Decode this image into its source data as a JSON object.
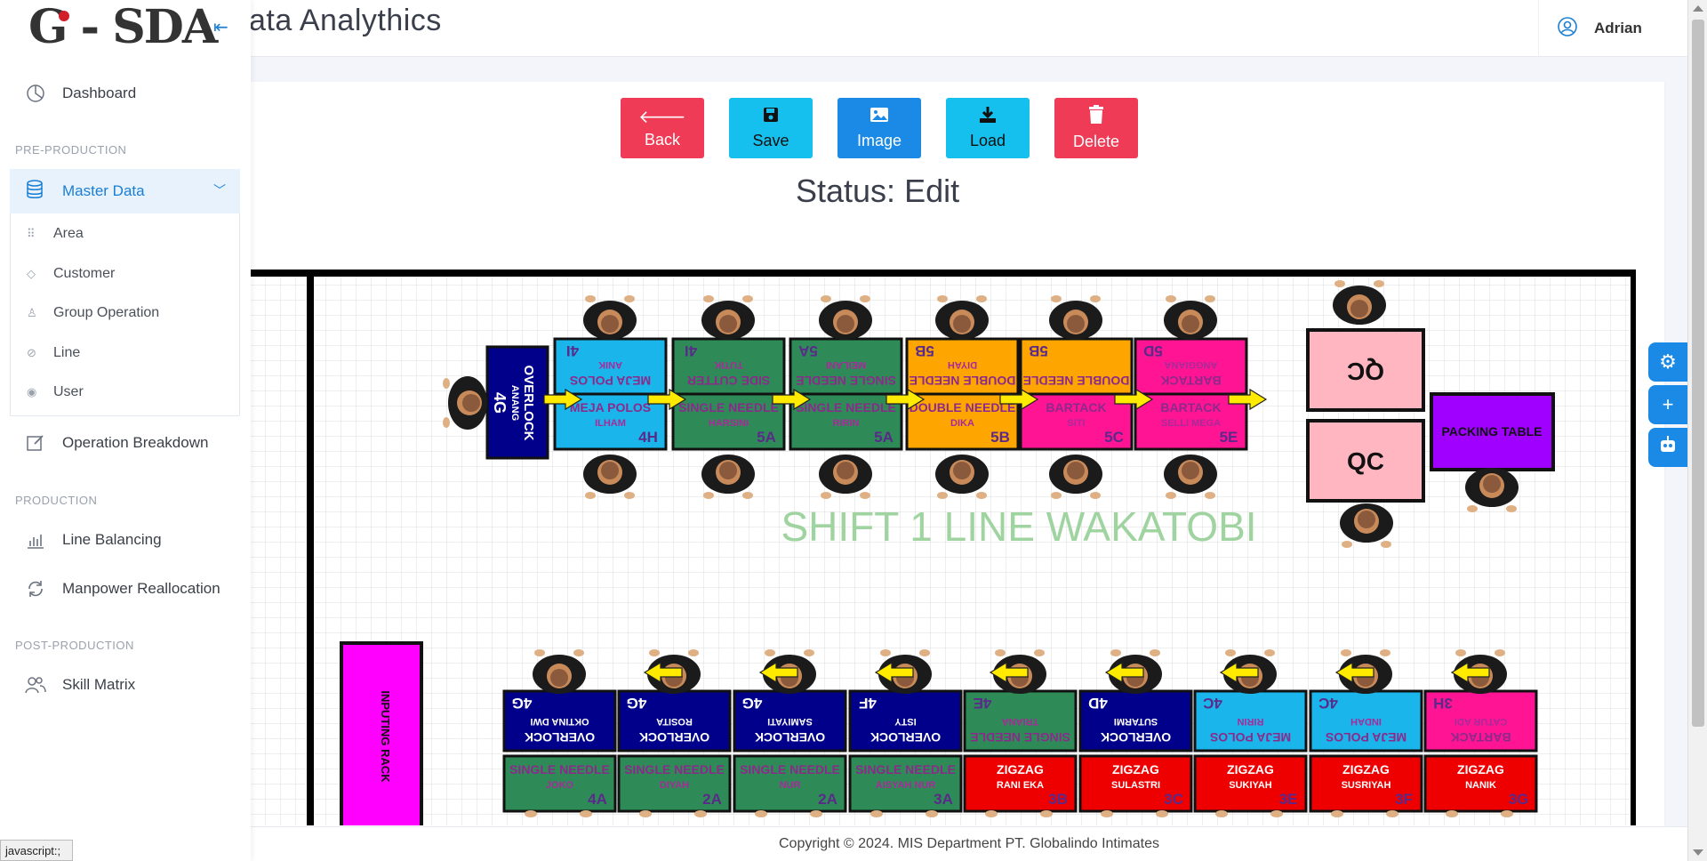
{
  "app": {
    "logo_text": "G - SDA",
    "page_title": "ata Analythics",
    "user_name": "Adrian"
  },
  "sidebar": {
    "dashboard": "Dashboard",
    "pre_production": "PRE-PRODUCTION",
    "master_data": "Master Data",
    "master_items": [
      "Area",
      "Customer",
      "Group Operation",
      "Line",
      "User"
    ],
    "operation_breakdown": "Operation Breakdown",
    "production": "PRODUCTION",
    "line_balancing": "Line Balancing",
    "manpower_reallocation": "Manpower Reallocation",
    "post_production": "POST-PRODUCTION",
    "skill_matrix": "Skill Matrix"
  },
  "toolbar": {
    "back": "Back",
    "save": "Save",
    "image": "Image",
    "load": "Load",
    "delete": "Delete"
  },
  "status_text": "Status: Edit",
  "floor": {
    "line_label": "SHIFT 1 LINE WAKATOBI",
    "packing_table": "PACKING TABLE",
    "qc1": "QC",
    "qc2": "QC",
    "inputing_rack": "INPUTING RACK",
    "overlock_vertical": {
      "machine": "OVERLOCK",
      "operator": "ANANG",
      "code": "4G"
    },
    "top_row_upper": [
      {
        "machine": "MEJA POLOS",
        "operator": "ANIK",
        "code": "4I",
        "color": "#1ab5ea"
      },
      {
        "machine": "SIDE CUTTER",
        "operator": "TUTIK",
        "code": "4I",
        "color": "#2e8b57"
      },
      {
        "machine": "SINGLE NEEDLE",
        "operator": "MEILANI",
        "code": "5A",
        "color": "#2e8b57"
      },
      {
        "machine": "DOUBLE NEEDLE",
        "operator": "DIYAH",
        "code": "5B",
        "color": "#ffa500"
      },
      {
        "machine": "DOUBLE NEEDLE",
        "operator": "",
        "code": "5B",
        "color": "#ffa500"
      },
      {
        "machine": "BARTACK",
        "operator": "ANGGIANA",
        "code": "5D",
        "color": "#ff1493"
      }
    ],
    "top_row_lower": [
      {
        "machine": "MEJA POLOS",
        "operator": "ILHAM",
        "code": "4H",
        "color": "#1ab5ea"
      },
      {
        "machine": "SINGLE NEEDLE",
        "operator": "HARSINI",
        "code": "5A",
        "color": "#2e8b57"
      },
      {
        "machine": "SINGLE NEEDLE",
        "operator": "RIRIN",
        "code": "5A",
        "color": "#2e8b57"
      },
      {
        "machine": "DOUBLE NEEDLE",
        "operator": "DIKA",
        "code": "5B",
        "color": "#ffa500"
      },
      {
        "machine": "BARTACK",
        "operator": "SITI",
        "code": "5C",
        "color": "#ff1493"
      },
      {
        "machine": "BARTACK",
        "operator": "SELLI MEGA",
        "code": "5E",
        "color": "#ff1493"
      }
    ],
    "bottom_row_upper": [
      {
        "machine": "OVERLOCK",
        "operator": "OKTINA DWI",
        "code": "4G",
        "color": "#00008b"
      },
      {
        "machine": "OVERLOCK",
        "operator": "ROSITA",
        "code": "4G",
        "color": "#00008b"
      },
      {
        "machine": "OVERLOCK",
        "operator": "SAMIYATI",
        "code": "4G",
        "color": "#00008b"
      },
      {
        "machine": "OVERLOCK",
        "operator": "ISTY",
        "code": "4F",
        "color": "#00008b"
      },
      {
        "machine": "SINGLE NEEDLE",
        "operator": "TRIANA",
        "code": "4E",
        "color": "#2e8b57"
      },
      {
        "machine": "OVERLOCK",
        "operator": "SUTARMI",
        "code": "4D",
        "color": "#00008b"
      },
      {
        "machine": "MEJA POLOS",
        "operator": "RIRIN",
        "code": "4C",
        "color": "#1ab5ea"
      },
      {
        "machine": "MEJA POLOS",
        "operator": "INDAH",
        "code": "4C",
        "color": "#1ab5ea"
      },
      {
        "machine": "BARTACK",
        "operator": "CATUR ADI",
        "code": "3H",
        "color": "#ff1493"
      }
    ],
    "bottom_row_lower": [
      {
        "machine": "SINGLE NEEDLE",
        "operator": "JOKO",
        "code": "4A",
        "color": "#2e8b57"
      },
      {
        "machine": "SINGLE NEEDLE",
        "operator": "DIYAH",
        "code": "2A",
        "color": "#2e8b57"
      },
      {
        "machine": "SINGLE NEEDLE",
        "operator": "NUR",
        "code": "2A",
        "color": "#2e8b57"
      },
      {
        "machine": "SINGLE NEEDLE",
        "operator": "AISYAH NUR",
        "code": "3A",
        "color": "#2e8b57"
      },
      {
        "machine": "ZIGZAG",
        "operator": "RANI EKA",
        "code": "3B",
        "color": "#ee0000"
      },
      {
        "machine": "ZIGZAG",
        "operator": "SULASTRI",
        "code": "3C",
        "color": "#ee0000"
      },
      {
        "machine": "ZIGZAG",
        "operator": "SUKIYAH",
        "code": "3E",
        "color": "#ee0000"
      },
      {
        "machine": "ZIGZAG",
        "operator": "SUSRIYAH",
        "code": "3F",
        "color": "#ee0000"
      },
      {
        "machine": "ZIGZAG",
        "operator": "NANIK",
        "code": "3G",
        "color": "#ee0000"
      }
    ]
  },
  "footer": "Copyright © 2024. MIS Department PT. Globalindo Intimates",
  "statusbar": "javascript:;",
  "colors": {
    "accent": "#1a7fd4",
    "btn_back": "#ef3b55",
    "btn_save": "#16c0ee",
    "btn_image": "#1a8ae6",
    "btn_load": "#16c0ee",
    "btn_delete": "#ef3b55"
  }
}
